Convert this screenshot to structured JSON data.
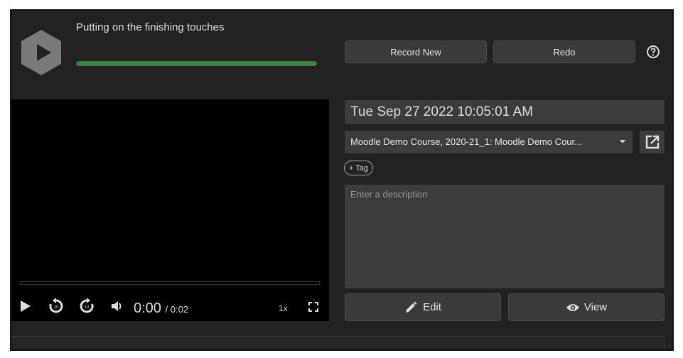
{
  "status": {
    "message": "Putting on the finishing touches",
    "progress_percent": 100,
    "progress_color": "#3f7d47"
  },
  "toolbar": {
    "record_new": "Record New",
    "redo": "Redo",
    "help_icon": "question-circle-icon"
  },
  "player": {
    "current_time": "0:00",
    "duration": "/ 0:02",
    "speed": "1x"
  },
  "form": {
    "title": "Tue Sep 27 2022 10:05:01 AM",
    "course": "Moodle Demo Course, 2020-21_1: Moodle Demo Cour...",
    "tag_button": "+ Tag",
    "description_placeholder": "Enter a description"
  },
  "actions": {
    "edit": "Edit",
    "view": "View"
  }
}
